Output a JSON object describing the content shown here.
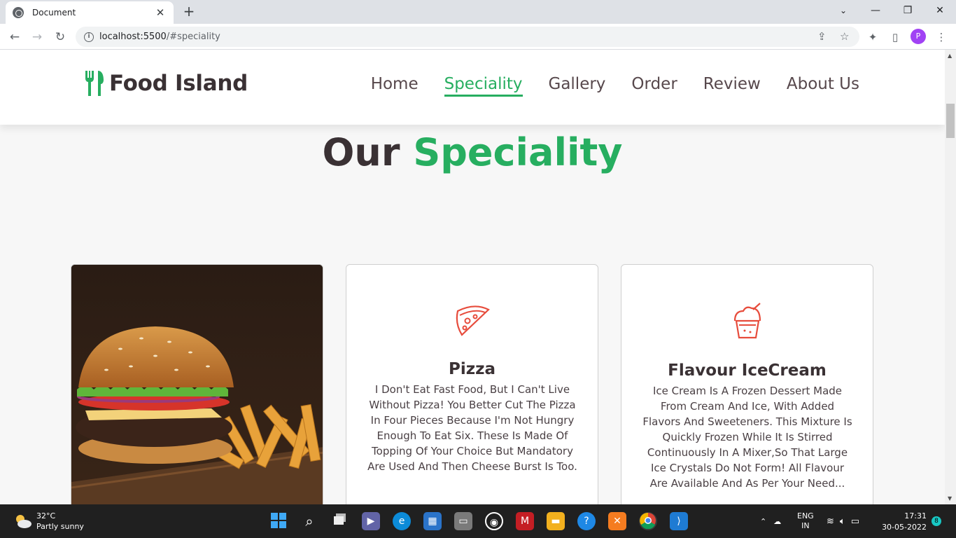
{
  "browser": {
    "tab_title": "Document",
    "url_host": "localhost:5500",
    "url_path": "/#speciality",
    "profile_initial": "P"
  },
  "site": {
    "logo_text": "Food Island",
    "accent": "#27ae60",
    "nav": [
      {
        "label": "Home",
        "active": false
      },
      {
        "label": "Speciality",
        "active": true
      },
      {
        "label": "Gallery",
        "active": false
      },
      {
        "label": "Order",
        "active": false
      },
      {
        "label": "Review",
        "active": false
      },
      {
        "label": "About Us",
        "active": false
      }
    ],
    "heading_plain": "Our",
    "heading_accent": "Speciality"
  },
  "cards": [
    {
      "type": "image",
      "subject": "burger-with-fries"
    },
    {
      "icon": "pizza-slice-icon",
      "title": "Pizza",
      "text": "I Don't Eat Fast Food, But I Can't Live Without Pizza! You Better Cut The Pizza In Four Pieces Because I'm Not Hungry Enough To Eat Six. These Is Made Of Topping Of Your Choice But Mandatory Are Used And Then Cheese Burst Is Too."
    },
    {
      "icon": "ice-cream-cup-icon",
      "title": "Flavour IceCream",
      "text": "Ice Cream Is A Frozen Dessert Made From Cream And Ice, With Added Flavors And Sweeteners. This Mixture Is Quickly Frozen While It Is Stirred Continuously In A Mixer,So That Large Ice Crystals Do Not Form! All Flavour Are Available And As Per Your Need..."
    }
  ],
  "taskbar": {
    "weather_temp": "32°C",
    "weather_desc": "Partly sunny",
    "lang_top": "ENG",
    "lang_bottom": "IN",
    "time": "17:31",
    "date": "30-05-2022",
    "notification_count": "8"
  }
}
